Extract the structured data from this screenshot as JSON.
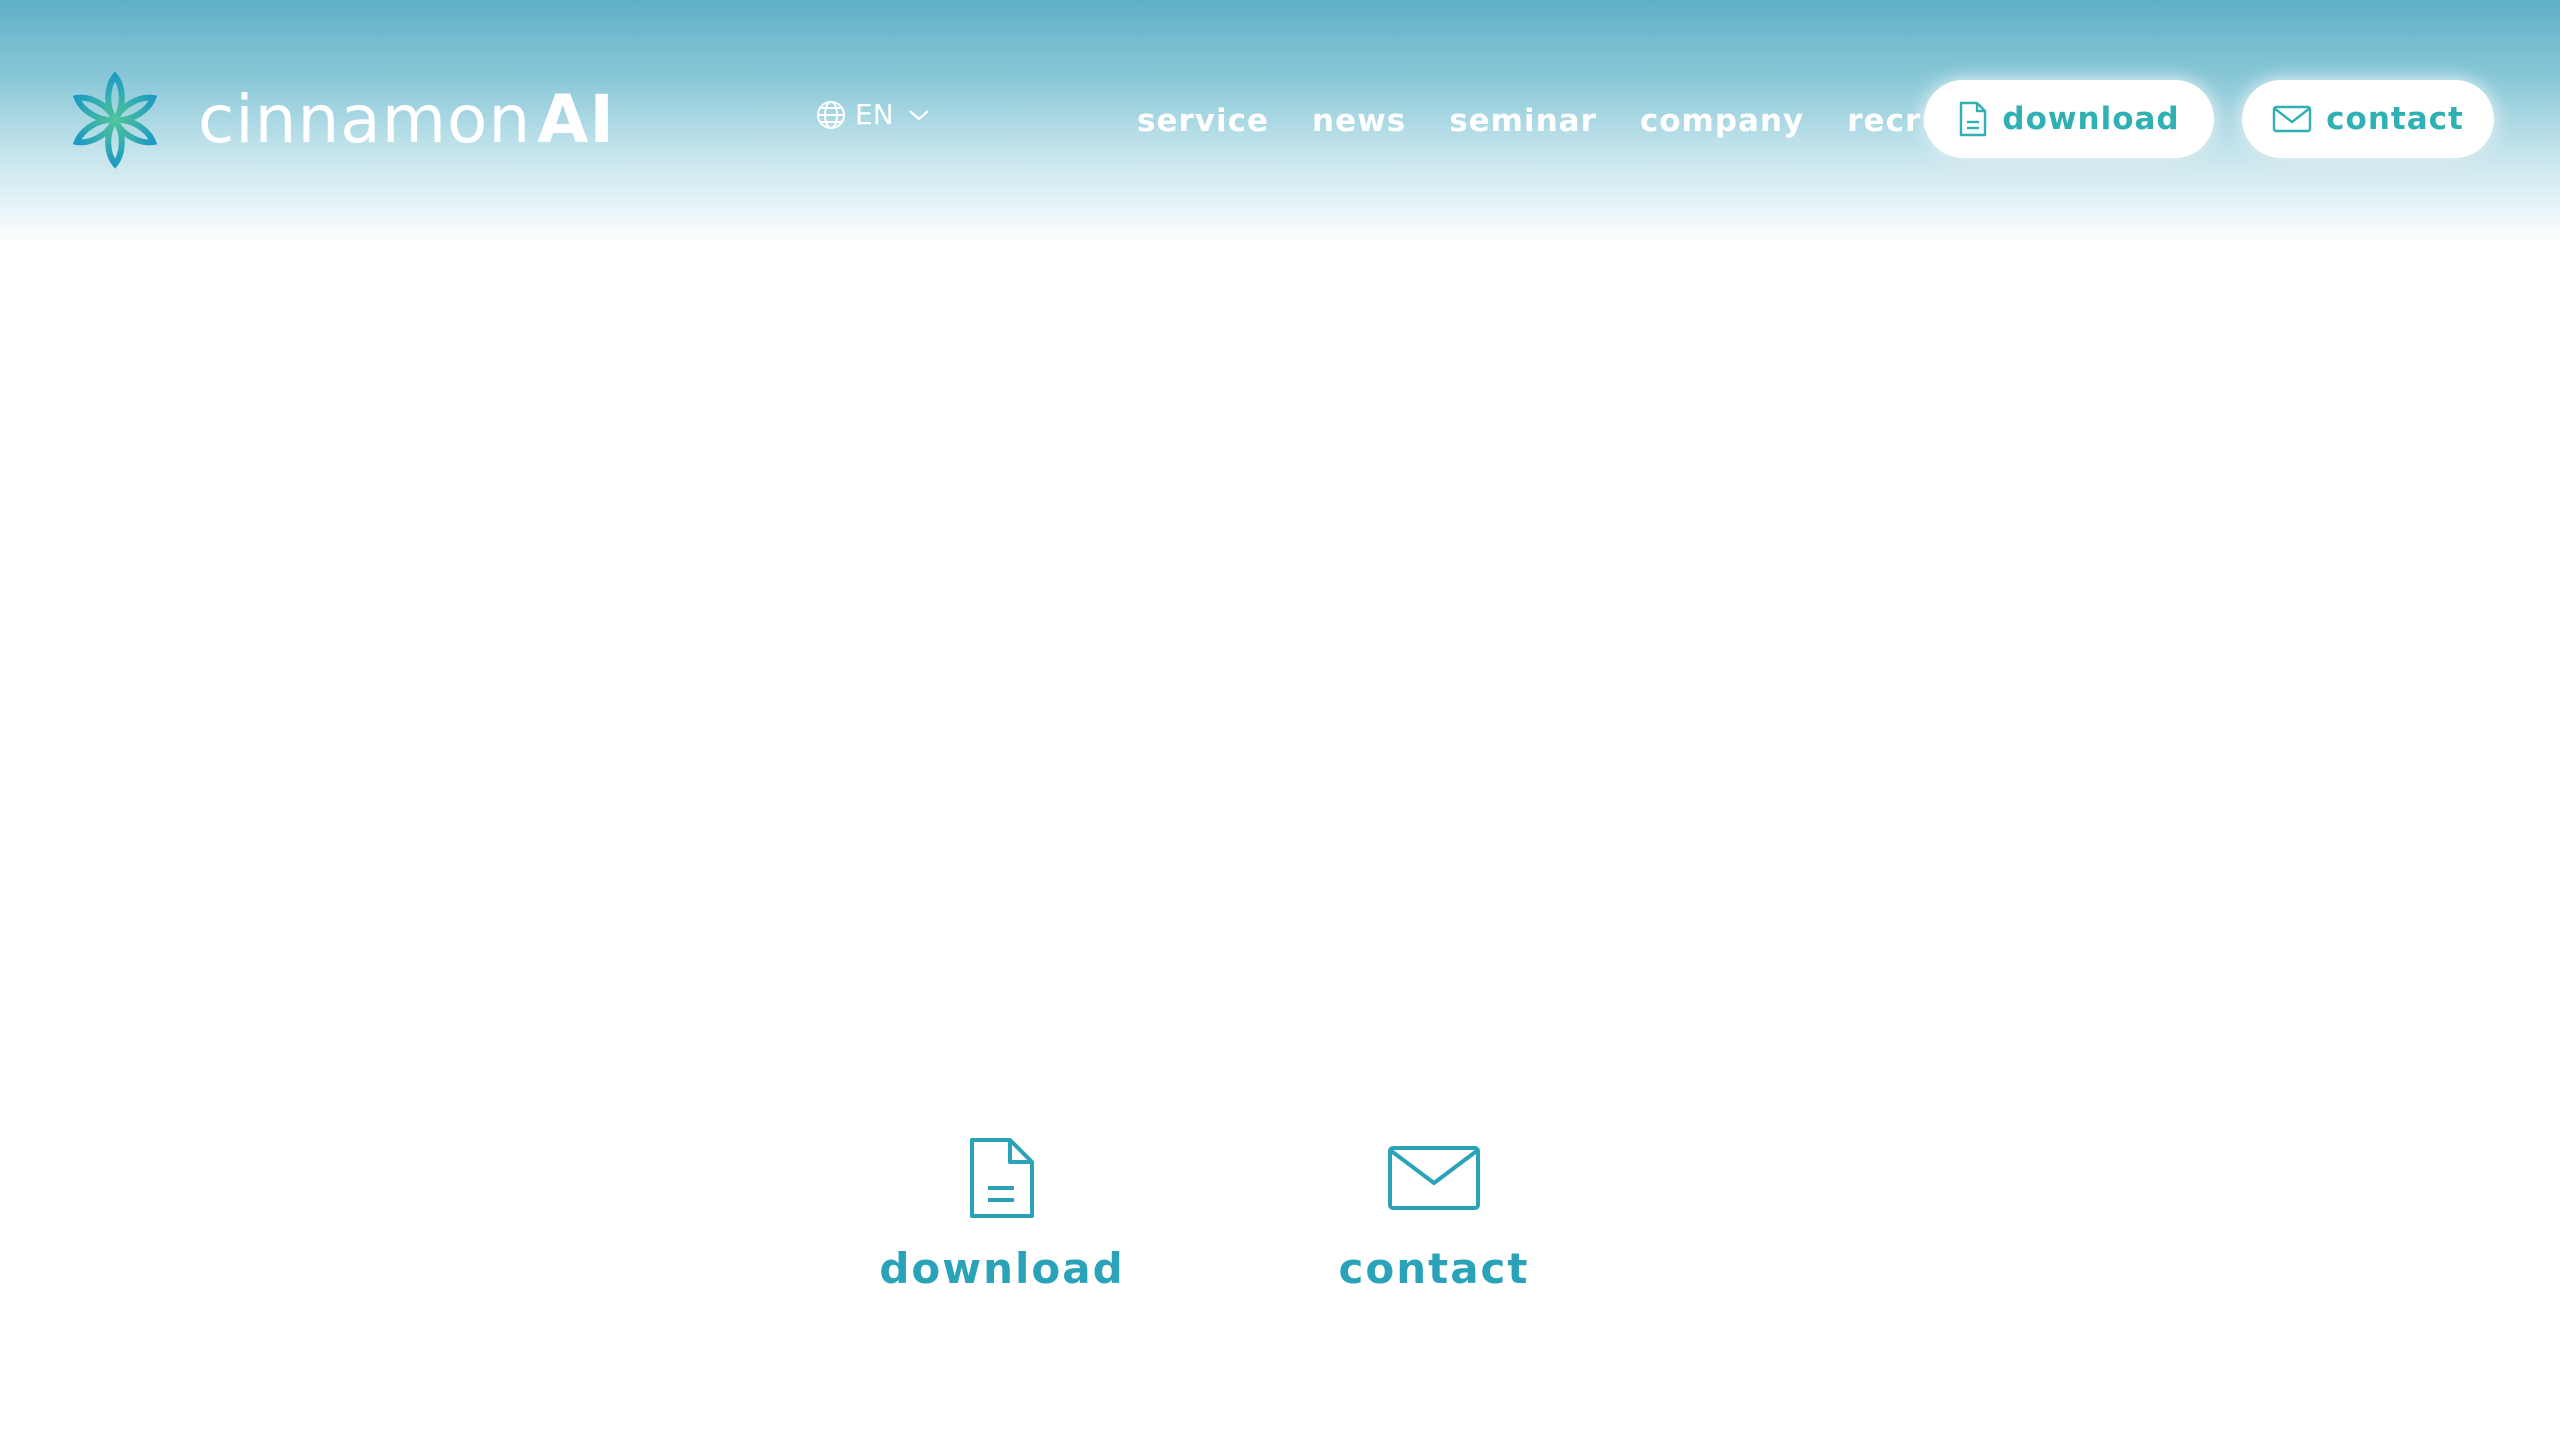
{
  "header": {
    "logo": {
      "word": "cinnamon",
      "suffix": "AI",
      "icon": "flower-logo-icon"
    },
    "language": {
      "current": "EN",
      "icon": "globe-icon",
      "dropdown_icon": "chevron-down-icon"
    },
    "nav": [
      {
        "label": "service"
      },
      {
        "label": "news"
      },
      {
        "label": "seminar"
      },
      {
        "label": "company"
      },
      {
        "label": "recruit"
      }
    ],
    "download_button": {
      "label": "download",
      "icon": "document-icon"
    },
    "contact_button": {
      "label": "contact",
      "icon": "mail-icon"
    }
  },
  "cta": {
    "download": {
      "label": "download",
      "icon": "document-icon"
    },
    "contact": {
      "label": "contact",
      "icon": "mail-icon"
    }
  },
  "colors": {
    "accent": "#2fb0b2",
    "accent_dark": "#2aa3b9",
    "header_top": "#5fb0c6"
  }
}
